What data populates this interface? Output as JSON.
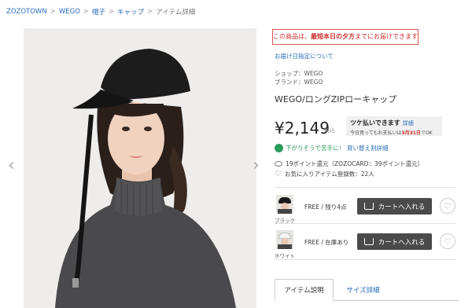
{
  "breadcrumb": [
    "ZOZOTOWN",
    "WEGO",
    "帽子",
    "キャップ"
  ],
  "breadcrumb_current": "アイテム詳細",
  "breadcrumb_sep": ">",
  "notice": {
    "prefix": "この商品は、",
    "highlight": "最短本日の夕方",
    "suffix": "までにお届けできます"
  },
  "shipping_link": "お届け日指定について",
  "shop": "ショップ：WEGO",
  "brand": "ブランド：WEGO",
  "product_name": "WEGO/ロングZIPローキャップ",
  "price": "¥2,149",
  "tax_label": "税込",
  "tsuke": {
    "title": "ツケ払いできます",
    "detail": "詳細",
    "sub_prefix": "今日買ってもお支払いは",
    "date": "3月31日",
    "sub_suffix": "でOK"
  },
  "price_drop": {
    "text": "下がりそうで苦手に！",
    "link": "買い替え割詳細"
  },
  "points": "19ポイント還元（ZOZOCARD：39ポイント還元）",
  "favorites": "お気に入りアイテム登録数：22人",
  "variants": [
    {
      "color": "ブラック",
      "stock": "FREE / 残り4点",
      "cart": "カートへ入れる"
    },
    {
      "color": "ホワイト",
      "stock": "FREE / 在庫あり",
      "cart": "カートへ入れる"
    }
  ],
  "tabs": [
    "アイテム説明",
    "サイズ詳細"
  ],
  "icons": {
    "prev": "chevron-left-icon",
    "next": "chevron-right-icon",
    "cart": "cart-icon",
    "heart": "heart-icon"
  },
  "colors": {
    "link": "#2a6db8",
    "alert": "#c9302c",
    "green": "#2a9d5c",
    "button": "#4a4a4a"
  }
}
